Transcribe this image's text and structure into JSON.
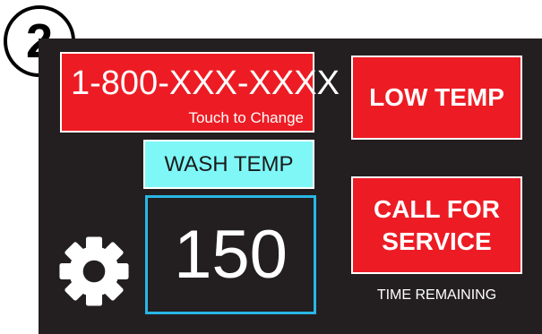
{
  "step_badge": "2",
  "phone_button": {
    "number": "1-800-XXX-XXXX",
    "hint": "Touch to Change"
  },
  "wash_temp": {
    "label": "WASH TEMP",
    "value": "150"
  },
  "alerts": {
    "low_temp": "LOW TEMP",
    "call_for_service": "CALL FOR\nSERVICE"
  },
  "time_remaining_label": "TIME REMAINING",
  "icons": {
    "settings": "gear-icon"
  },
  "colors": {
    "panel_background": "#231f20",
    "alert_red": "#ed1c24",
    "label_cyan": "#7ff7f7",
    "value_border_blue": "#29b6e6"
  }
}
